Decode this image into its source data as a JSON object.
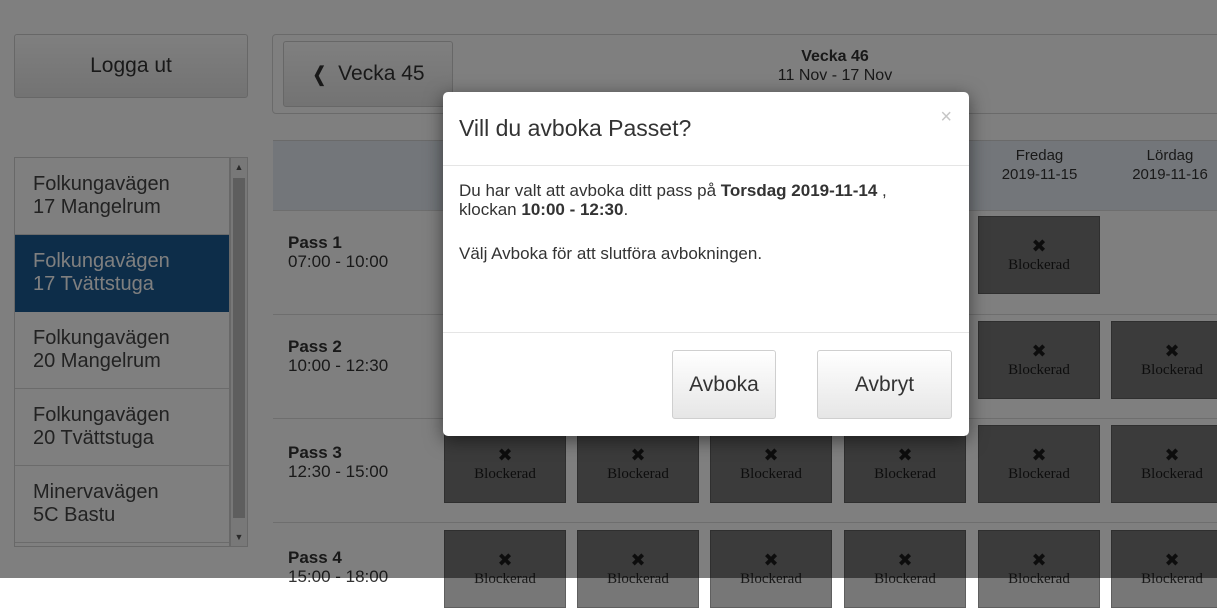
{
  "sidebar": {
    "logout_label": "Logga ut",
    "rooms": [
      {
        "line1": "Folkungavägen",
        "line2": "17 Mangelrum",
        "active": false
      },
      {
        "line1": "Folkungavägen",
        "line2": "17 Tvättstuga",
        "active": true
      },
      {
        "line1": "Folkungavägen",
        "line2": "20 Mangelrum",
        "active": false
      },
      {
        "line1": "Folkungavägen",
        "line2": "20 Tvättstuga",
        "active": false
      },
      {
        "line1": "Minervavägen",
        "line2": "5C Bastu",
        "active": false
      }
    ]
  },
  "week": {
    "prev_label": "Vecka 45",
    "prev_icon": "chevron-left-icon",
    "title": "Vecka 46",
    "range": "11 Nov - 17 Nov"
  },
  "schedule": {
    "days": [
      {
        "name": "",
        "date": ""
      },
      {
        "name": "",
        "date": ""
      },
      {
        "name": "",
        "date": ""
      },
      {
        "name": "",
        "date": ""
      },
      {
        "name": "Fredag",
        "date": "2019-11-15"
      },
      {
        "name": "Lördag",
        "date": "2019-11-16"
      }
    ],
    "passes": [
      {
        "name": "Pass 1",
        "time": "07:00 - 10:00"
      },
      {
        "name": "Pass 2",
        "time": "10:00 - 12:30"
      },
      {
        "name": "Pass 3",
        "time": "12:30 - 15:00"
      },
      {
        "name": "Pass 4",
        "time": "15:00 - 18:00"
      }
    ],
    "blocked_label": "Blockerad",
    "blocked_icon": "close-x-icon",
    "cell_color": "#777777"
  },
  "modal": {
    "title": "Vill du avboka Passet?",
    "close_glyph": "×",
    "intro": "Du har valt att avboka ditt pass på ",
    "date_bold": "Torsdag 2019-11-14",
    "comma": " ,",
    "time_prefix": "klockan ",
    "time_bold": "10:00 - 12:30",
    "time_suffix": ".",
    "instruction": "Välj Avboka för att slutföra avbokningen.",
    "confirm_label": "Avboka",
    "cancel_label": "Avbryt"
  },
  "colors": {
    "active_room": "#1b5a92",
    "grid_header": "#e7edf4",
    "overlay": "rgba(0,0,0,0.5)"
  }
}
